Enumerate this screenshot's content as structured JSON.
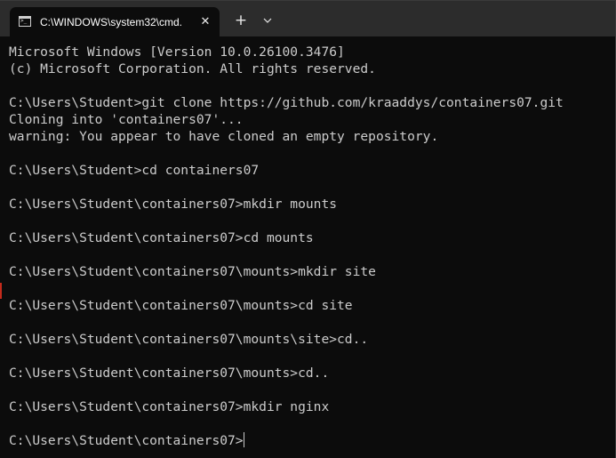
{
  "window": {
    "tab_title": "C:\\WINDOWS\\system32\\cmd.",
    "tab_close": "✕",
    "new_tab": "+",
    "tab_icon_text": ">_"
  },
  "icons": {
    "tab_icon": "cmd-terminal-icon",
    "close": "close-icon",
    "new_tab": "plus-icon",
    "dropdown": "chevron-down-icon"
  },
  "colors": {
    "background": "#0c0c0c",
    "titlebar": "#2c2c2c",
    "text": "#cccccc"
  },
  "terminal": {
    "lines": [
      "Microsoft Windows [Version 10.0.26100.3476]",
      "(c) Microsoft Corporation. All rights reserved.",
      "",
      "C:\\Users\\Student>git clone https://github.com/kraaddys/containers07.git",
      "Cloning into 'containers07'...",
      "warning: You appear to have cloned an empty repository.",
      "",
      "C:\\Users\\Student>cd containers07",
      "",
      "C:\\Users\\Student\\containers07>mkdir mounts",
      "",
      "C:\\Users\\Student\\containers07>cd mounts",
      "",
      "C:\\Users\\Student\\containers07\\mounts>mkdir site",
      "",
      "C:\\Users\\Student\\containers07\\mounts>cd site",
      "",
      "C:\\Users\\Student\\containers07\\mounts\\site>cd..",
      "",
      "C:\\Users\\Student\\containers07\\mounts>cd..",
      "",
      "C:\\Users\\Student\\containers07>mkdir nginx",
      ""
    ],
    "prompt": "C:\\Users\\Student\\containers07>"
  }
}
